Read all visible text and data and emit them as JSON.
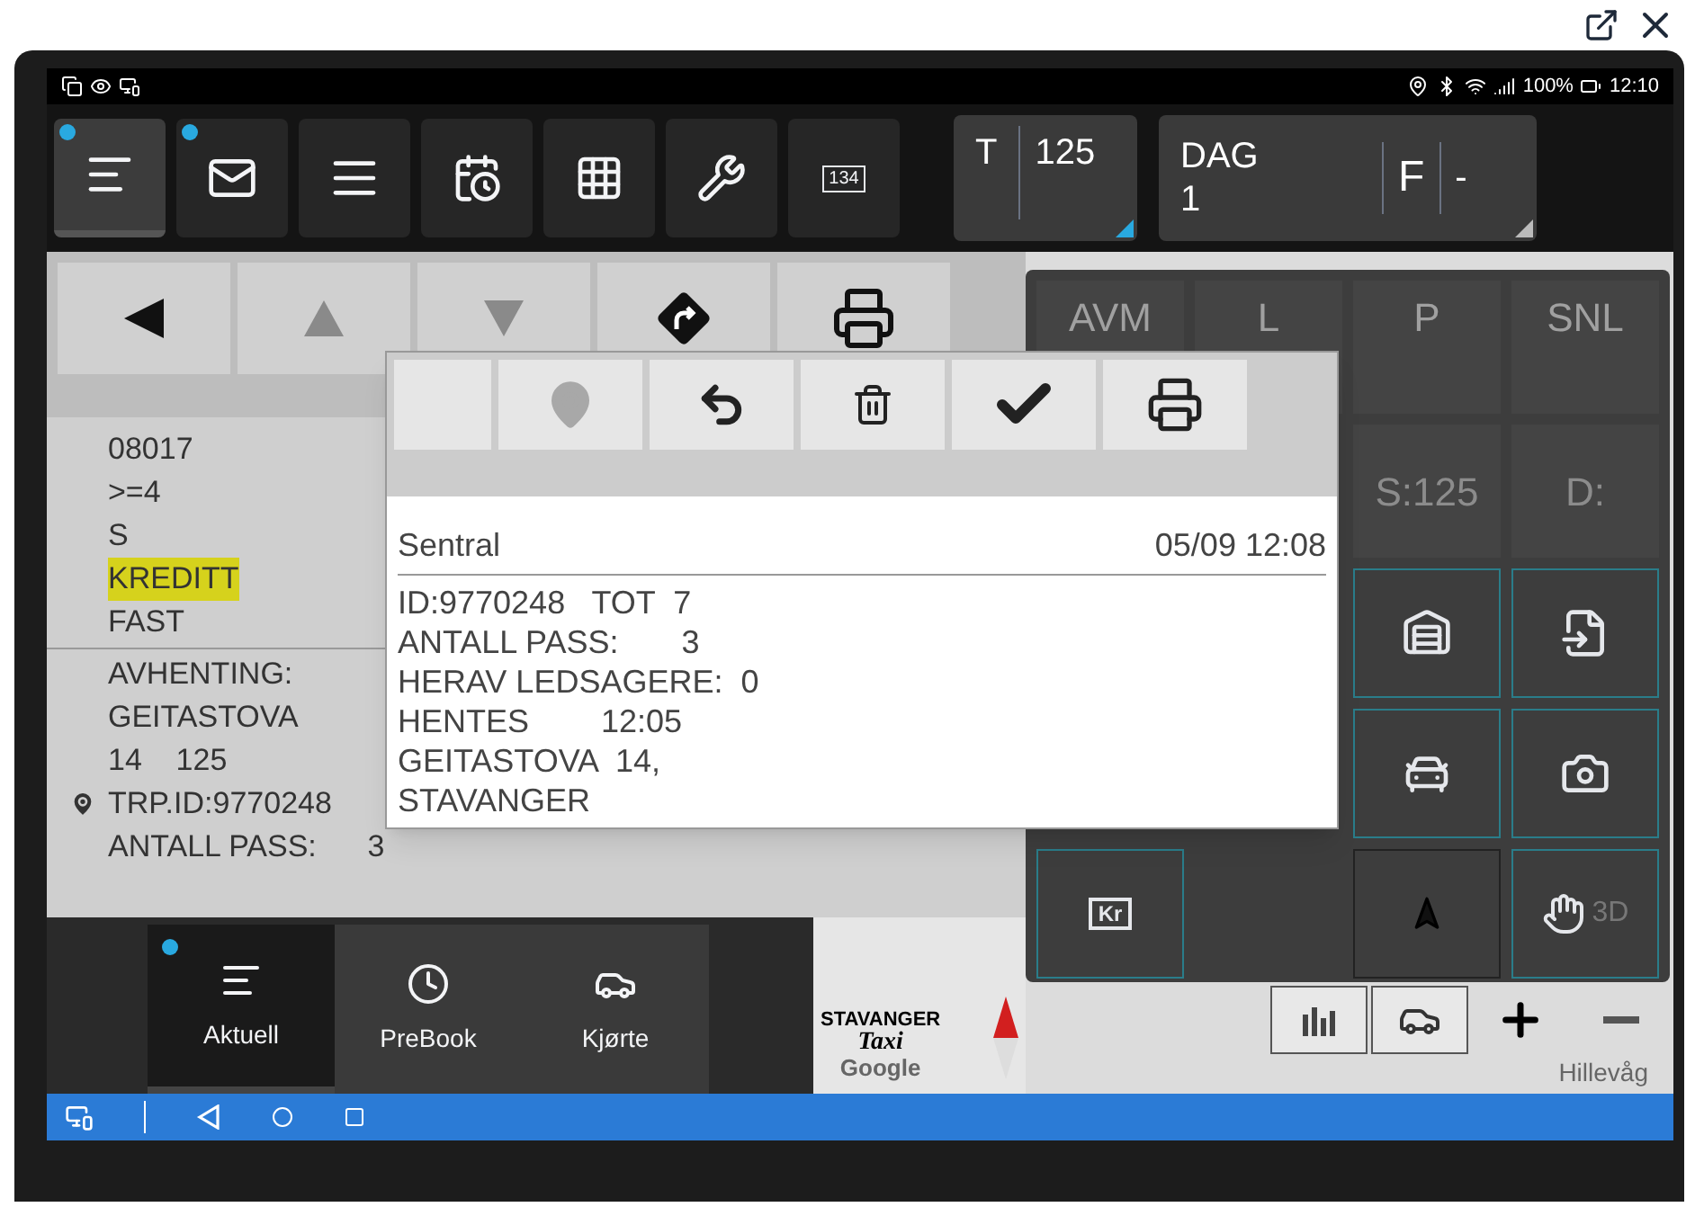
{
  "status_bar": {
    "battery": "100%",
    "time": "12:10"
  },
  "toolbar": {
    "buttons": [
      {
        "kind": "list",
        "selected": true,
        "badge": true
      },
      {
        "kind": "mail",
        "selected": false,
        "badge": true
      },
      {
        "kind": "menu",
        "selected": false,
        "badge": false
      },
      {
        "kind": "schedule",
        "selected": false,
        "badge": false
      },
      {
        "kind": "grid",
        "selected": false,
        "badge": false
      },
      {
        "kind": "tools",
        "selected": false,
        "badge": false
      },
      {
        "kind": "counter",
        "selected": false,
        "badge": false,
        "label": "134"
      }
    ],
    "zone": {
      "label": "T",
      "value": "125"
    },
    "shift": {
      "label": "DAG",
      "value": "1",
      "status": "F",
      "extra": "-"
    }
  },
  "trip_panel": {
    "nav": [
      {
        "kind": "back",
        "disabled": false
      },
      {
        "kind": "up",
        "disabled": true
      },
      {
        "kind": "down",
        "disabled": true
      },
      {
        "kind": "turn",
        "disabled": false
      },
      {
        "kind": "print",
        "disabled": false
      }
    ],
    "lines": [
      {
        "text": "08017",
        "highlighted": false
      },
      {
        "text": ">=4",
        "highlighted": false
      },
      {
        "text": "S",
        "highlighted": false
      },
      {
        "text": "KREDITT",
        "highlighted": true
      },
      {
        "text": "FAST",
        "highlighted": false
      }
    ],
    "pickup": [
      "AVHENTING:",
      "GEITASTOVA",
      "14    125"
    ],
    "trip_id": "TRP.ID:9770248",
    "passengers": "ANTALL PASS:      3"
  },
  "message": {
    "actions": [
      {
        "kind": "pin",
        "disabled": true
      },
      {
        "kind": "reply",
        "disabled": false
      },
      {
        "kind": "delete",
        "disabled": false
      },
      {
        "kind": "confirm",
        "disabled": false
      },
      {
        "kind": "print",
        "disabled": false
      }
    ],
    "sender": "Sentral",
    "time": "05/09 12:08",
    "lines": [
      "ID:9770248   TOT  7",
      "ANTALL PASS:       3",
      "HERAV LEDSAGERE:  0",
      "HENTES        12:05",
      "GEITASTOVA  14,",
      "STAVANGER"
    ]
  },
  "map_panel": {
    "row_1": [
      "AVM",
      "L",
      "P",
      "SNL"
    ],
    "row_2": [
      "S:125",
      "D:"
    ],
    "view_label": "3D",
    "payment_label": "Kr",
    "place_label": "Hillevåg"
  },
  "bottom_tabs": [
    {
      "label": "Aktuell",
      "kind": "list",
      "selected": true,
      "badge": true
    },
    {
      "label": "PreBook",
      "kind": "clock",
      "selected": false,
      "badge": false
    },
    {
      "label": "Kjørte",
      "kind": "car",
      "selected": false,
      "badge": false
    }
  ],
  "logo": {
    "brand": "STAVANGER",
    "sub": "Taxi",
    "credit": "Google"
  }
}
